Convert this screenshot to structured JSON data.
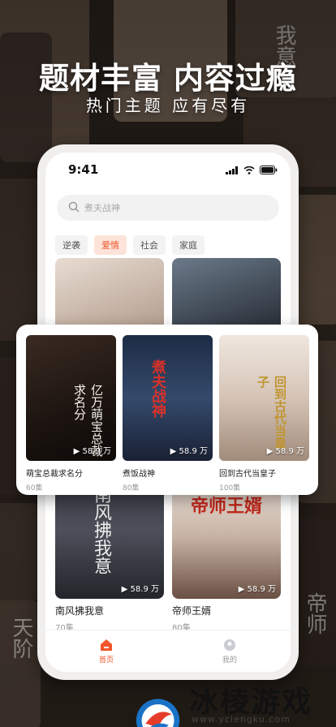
{
  "hero": {
    "title": "题材丰富 内容过瘾",
    "subtitle": "热门主题 应有尽有"
  },
  "status": {
    "time": "9:41"
  },
  "search": {
    "placeholder": "煮夫战神"
  },
  "tags": [
    {
      "label": "逆袭",
      "active": false
    },
    {
      "label": "爱情",
      "active": true
    },
    {
      "label": "社会",
      "active": false
    },
    {
      "label": "家庭",
      "active": false
    }
  ],
  "grid": [
    {
      "title": "",
      "episodes": "",
      "plays": ""
    },
    {
      "title": "",
      "episodes": "",
      "plays": ""
    },
    {
      "title": "南风拂我意",
      "episodes": "70集",
      "plays": "58.9 万",
      "poster_text": "南风拂我意"
    },
    {
      "title": "帝师王婿",
      "episodes": "80集",
      "plays": "58.9 万",
      "poster_text": "帝师王婿"
    }
  ],
  "panel": [
    {
      "title": "萌宝总裁求名分",
      "episodes": "60集",
      "plays": "58.9 万",
      "poster_text": "亿万萌宝总裁求名分"
    },
    {
      "title": "煮饭战神",
      "episodes": "80集",
      "plays": "58.9 万",
      "poster_text": "煮夫战神"
    },
    {
      "title": "回到古代当皇子",
      "episodes": "100集",
      "plays": "58.9 万",
      "poster_text": "回到古代当皇子"
    }
  ],
  "tabbar": [
    {
      "label": "首页",
      "icon": "home-icon",
      "active": true
    },
    {
      "label": "我的",
      "icon": "profile-icon",
      "active": false
    }
  ],
  "brand": {
    "name": "冰棱游戏网",
    "url": "www.yclengku.com"
  },
  "colors": {
    "accent": "#f0552c",
    "brand_blue": "#1a73c7"
  }
}
